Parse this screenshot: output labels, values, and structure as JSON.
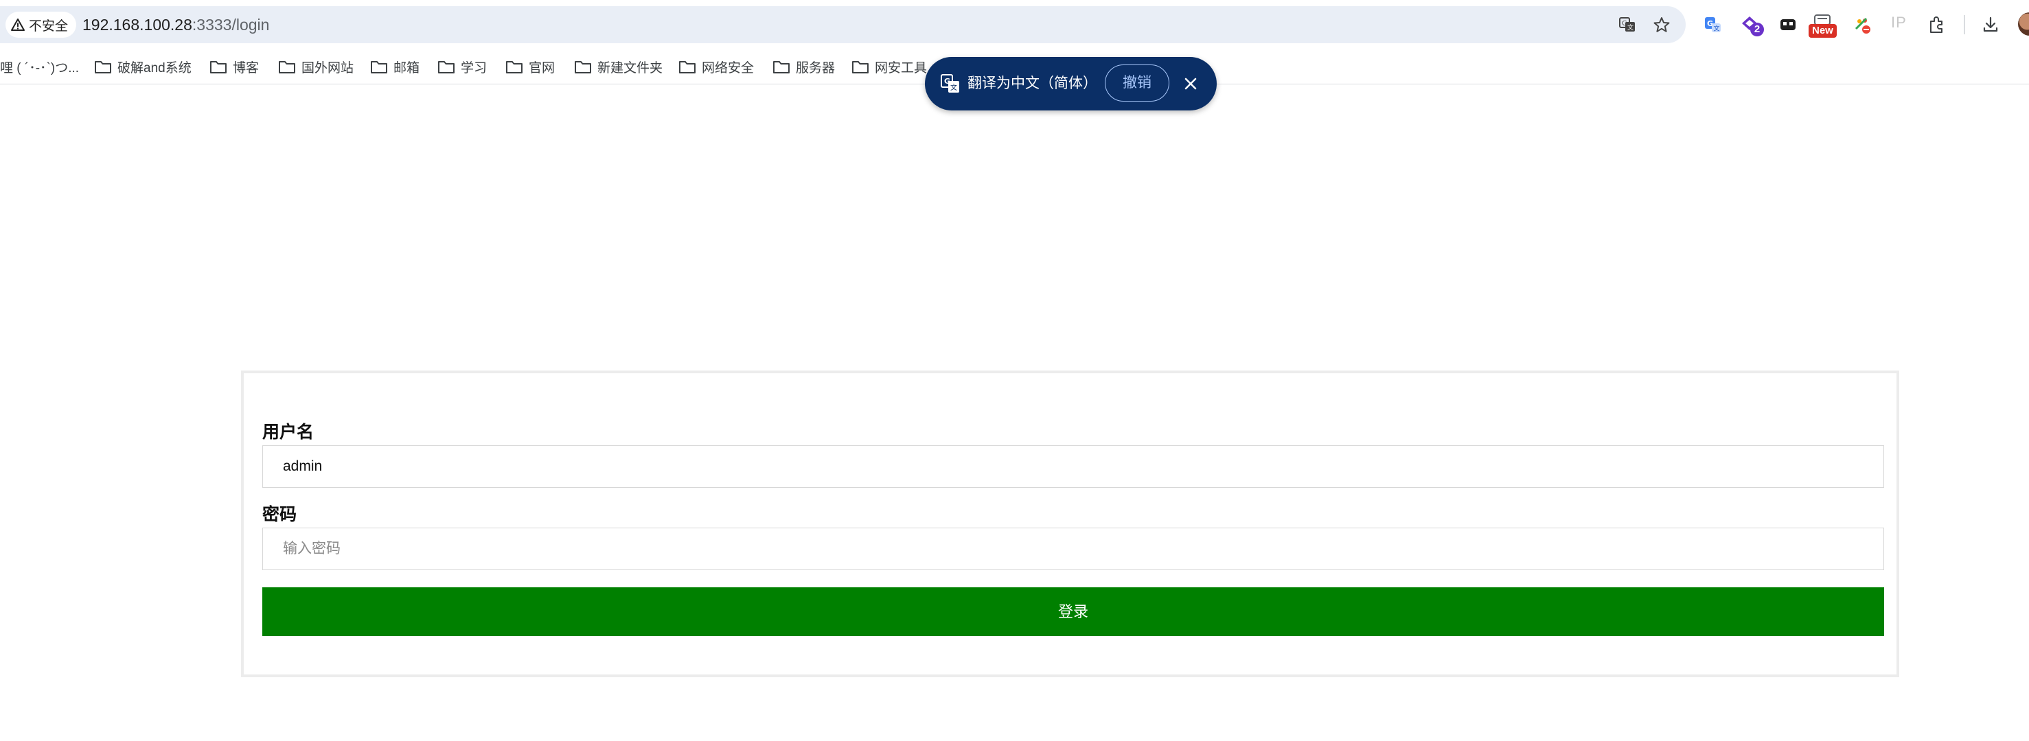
{
  "browser": {
    "security_label": "不安全",
    "url_host": "192.168.100.28",
    "url_rest": ":3333/login",
    "extensions": [
      "translate-extension-icon",
      "purple-extension-icon",
      "game-extension-icon",
      "new-extension-icon",
      "palette-extension-icon",
      "ip-extension-icon",
      "puzzle-icon",
      "download-icon"
    ],
    "extension_badge_count": "2",
    "extension_badge_new": "New",
    "ip_text": "IP"
  },
  "bookmarks": [
    {
      "label": "哩 ( ´･-･`)つ..."
    },
    {
      "label": "破解and系统"
    },
    {
      "label": "博客"
    },
    {
      "label": "国外网站"
    },
    {
      "label": "邮箱"
    },
    {
      "label": "学习"
    },
    {
      "label": "官网"
    },
    {
      "label": "新建文件夹"
    },
    {
      "label": "网络安全"
    },
    {
      "label": "服务器"
    },
    {
      "label": "网安工具"
    }
  ],
  "translate_bar": {
    "text": "翻译为中文（简体）",
    "undo_label": "撤销"
  },
  "login": {
    "username_label": "用户名",
    "username_value": "admin",
    "password_label": "密码",
    "password_placeholder": "输入密码",
    "submit_label": "登录",
    "submit_color": "#008000"
  }
}
